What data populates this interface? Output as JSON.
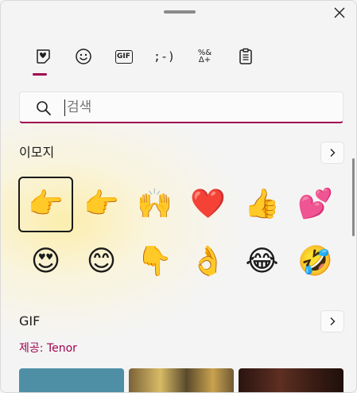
{
  "window": {
    "close_glyph": "✕"
  },
  "tabs": [
    {
      "name": "emoji",
      "icon": "heart-sticker-icon",
      "label": ""
    },
    {
      "name": "kaomoji-face",
      "icon": "smiley-icon",
      "label": ""
    },
    {
      "name": "gif",
      "icon": "gif-icon",
      "label": "GIF"
    },
    {
      "name": "kaomoji",
      "icon": "kaomoji-icon",
      "label": ";-)"
    },
    {
      "name": "symbols",
      "icon": "symbols-icon",
      "label": "%&"
    },
    {
      "name": "clipboard",
      "icon": "clipboard-icon",
      "label": ""
    }
  ],
  "active_tab": "emoji",
  "search": {
    "placeholder": "검색",
    "value": ""
  },
  "emoji_section": {
    "title": "이모지",
    "more_glyph": "›",
    "items": [
      "👉",
      "👉",
      "🙌",
      "❤️",
      "👍",
      "💕",
      "😍",
      "😊",
      "👇",
      "👌",
      "😂",
      "🤣"
    ]
  },
  "gif_section": {
    "title": "GIF",
    "provider": "제공: Tenor",
    "more_glyph": "›"
  },
  "colors": {
    "accent": "#a0044f",
    "background": "#f4f4f4"
  }
}
